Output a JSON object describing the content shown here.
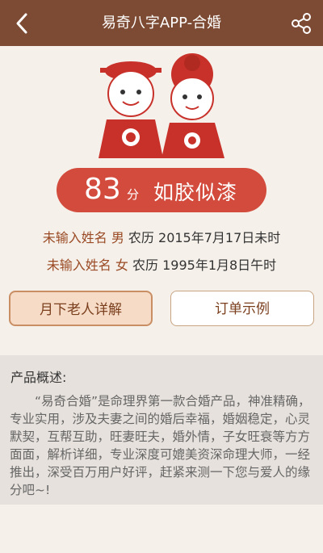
{
  "header": {
    "title": "易奇八字APP-合婚"
  },
  "score": {
    "value": "83",
    "unit": "分",
    "description": "如胶似漆"
  },
  "people": [
    {
      "name": "未输入姓名",
      "gender": "男",
      "date": "农历 2015年7月17日未时"
    },
    {
      "name": "未输入姓名",
      "gender": "女",
      "date": "农历 1995年1月8日午时"
    }
  ],
  "buttons": {
    "detail": "月下老人详解",
    "order": "订单示例"
  },
  "product": {
    "title": "产品概述:",
    "body": "“易奇合婚”是命理界第一款合婚产品，神准精确，专业实用，涉及夫妻之间的婚后幸福，婚姻稳定，心灵默契，互帮互助，旺妻旺夫，婚外情，子女旺衰等方方面面，解析详细，专业深度可媲美资深命理大师，一经推出，深受百万用户好评，赶紧来测一下您与爱人的缘分吧~!"
  },
  "colors": {
    "header": "#7d4b33",
    "accent": "#d24b3c",
    "background": "#f5f0ea"
  }
}
